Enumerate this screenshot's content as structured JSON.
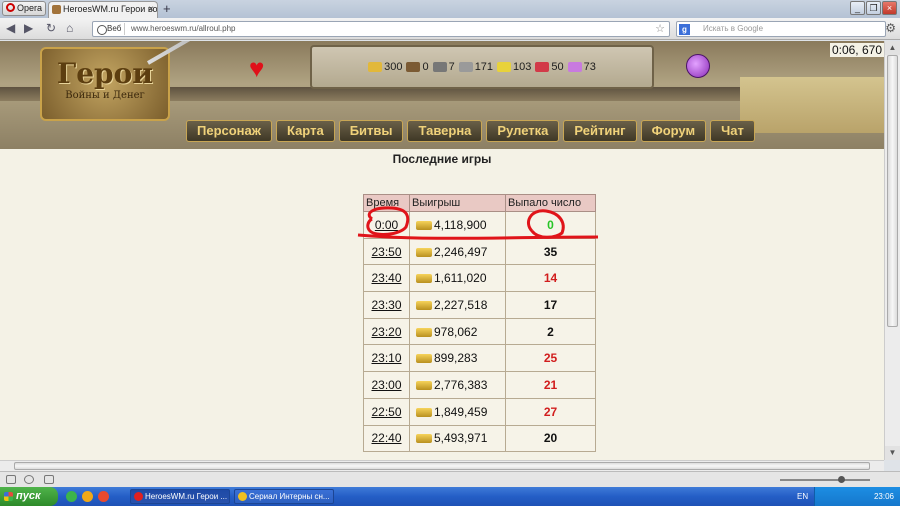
{
  "browser": {
    "menu_label": "Opera",
    "tab_title": "HeroesWM.ru Герои вой...",
    "url": "www.heroeswm.ru/allroul.php",
    "web_label": "Веб",
    "search_placeholder": "Искать в Google"
  },
  "game": {
    "logo_title": "Герои",
    "logo_subtitle": "Войны и Денег",
    "clock": "0:06, 670",
    "resources": [
      {
        "name": "gold",
        "value": "300",
        "color": "#e2b83a"
      },
      {
        "name": "wood",
        "value": "0",
        "color": "#7b5a33"
      },
      {
        "name": "ore",
        "value": "7",
        "color": "#777777"
      },
      {
        "name": "mercury",
        "value": "171",
        "color": "#9a9a9a"
      },
      {
        "name": "sulfur",
        "value": "103",
        "color": "#e8d23a"
      },
      {
        "name": "crystal",
        "value": "50",
        "color": "#d23a48"
      },
      {
        "name": "gems",
        "value": "73",
        "color": "#c87adf"
      }
    ],
    "menu": [
      "Персонаж",
      "Карта",
      "Битвы",
      "Таверна",
      "Рулетка",
      "Рейтинг",
      "Форум",
      "Чат"
    ]
  },
  "page": {
    "heading": "Последние игры",
    "columns": [
      "Время",
      "Выигрыш",
      "Выпало число"
    ],
    "rows": [
      {
        "time": "0:00",
        "win": "4,118,900",
        "number": "0",
        "color": "green"
      },
      {
        "time": "23:50",
        "win": "2,246,497",
        "number": "35",
        "color": "black"
      },
      {
        "time": "23:40",
        "win": "1,611,020",
        "number": "14",
        "color": "red"
      },
      {
        "time": "23:30",
        "win": "2,227,518",
        "number": "17",
        "color": "black"
      },
      {
        "time": "23:20",
        "win": "978,062",
        "number": "2",
        "color": "black"
      },
      {
        "time": "23:10",
        "win": "899,283",
        "number": "25",
        "color": "red"
      },
      {
        "time": "23:00",
        "win": "2,776,383",
        "number": "21",
        "color": "red"
      },
      {
        "time": "22:50",
        "win": "1,849,459",
        "number": "27",
        "color": "red"
      },
      {
        "time": "22:40",
        "win": "5,493,971",
        "number": "20",
        "color": "black"
      }
    ]
  },
  "taskbar": {
    "start_label": "пуск",
    "tasks": [
      "HeroesWM.ru Герои ...",
      "Сериал Интерны сн..."
    ],
    "lang": "EN",
    "time": "23:06"
  }
}
